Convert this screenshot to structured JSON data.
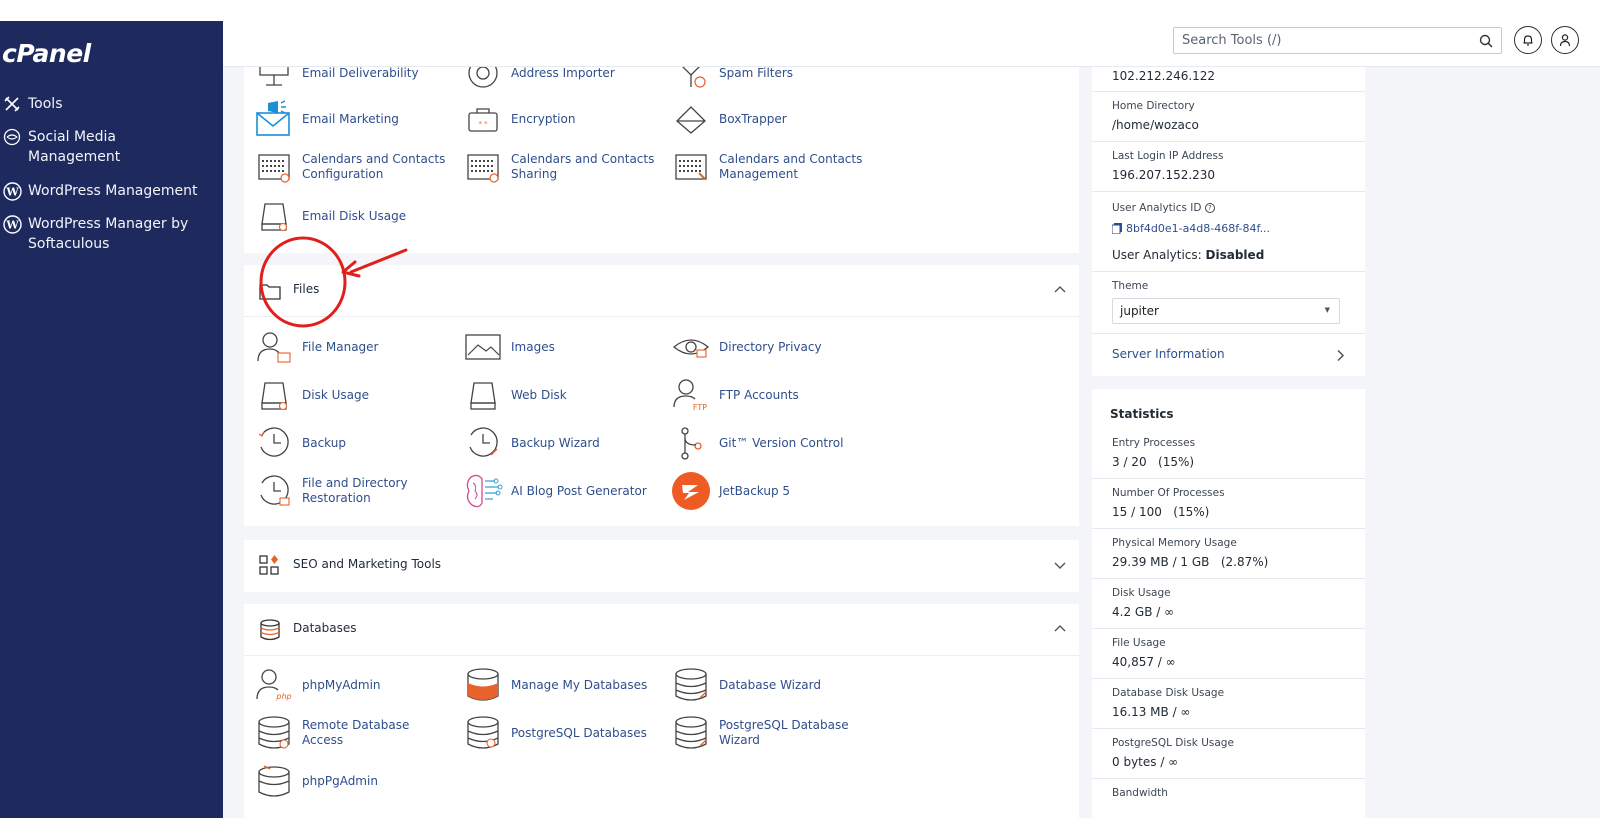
{
  "sidebar": {
    "logo": "cPanel",
    "items": [
      {
        "label": "Tools"
      },
      {
        "label": "Social Media",
        "label2": "Management"
      },
      {
        "label": "WordPress Management"
      },
      {
        "label": "WordPress Manager by",
        "label2": "Softaculous"
      }
    ]
  },
  "search": {
    "placeholder": "Search Tools (/)"
  },
  "email_tools": [
    {
      "label": "Email Deliverability"
    },
    {
      "label": "Address Importer"
    },
    {
      "label": "Spam Filters"
    },
    {
      "label": "Email Marketing"
    },
    {
      "label": "Encryption"
    },
    {
      "label": "BoxTrapper"
    },
    {
      "label": "Calendars and Contacts",
      "label2": "Configuration"
    },
    {
      "label": "Calendars and Contacts",
      "label2": "Sharing"
    },
    {
      "label": "Calendars and Contacts",
      "label2": "Management"
    },
    {
      "label": "Email Disk Usage"
    }
  ],
  "files": {
    "title": "Files",
    "tools": [
      {
        "label": "File Manager"
      },
      {
        "label": "Images"
      },
      {
        "label": "Directory Privacy"
      },
      {
        "label": "Disk Usage"
      },
      {
        "label": "Web Disk"
      },
      {
        "label": "FTP Accounts"
      },
      {
        "label": "Backup"
      },
      {
        "label": "Backup Wizard"
      },
      {
        "label": "Git™ Version Control"
      },
      {
        "label": "File and Directory",
        "label2": "Restoration"
      },
      {
        "label": "AI Blog Post Generator"
      },
      {
        "label": "JetBackup 5"
      }
    ]
  },
  "seo": {
    "title": "SEO and Marketing Tools"
  },
  "databases": {
    "title": "Databases",
    "tools": [
      {
        "label": "phpMyAdmin"
      },
      {
        "label": "Manage My Databases"
      },
      {
        "label": "Database Wizard"
      },
      {
        "label": "Remote Database Access"
      },
      {
        "label": "PostgreSQL Databases"
      },
      {
        "label": "PostgreSQL Database Wizard"
      },
      {
        "label": "phpPgAdmin"
      }
    ]
  },
  "general_info": {
    "ip_value": "102.212.246.122",
    "home_dir_label": "Home Directory",
    "home_dir_value": "/home/wozaco",
    "last_login_label": "Last Login IP Address",
    "last_login_value": "196.207.152.230",
    "analytics_id_label": "User Analytics ID",
    "analytics_id_value": "8bf4d0e1-a4d8-468f-84f...",
    "analytics_status_label": "User Analytics:",
    "analytics_status_value": "Disabled",
    "theme_label": "Theme",
    "theme_value": "jupiter",
    "server_info_label": "Server Information"
  },
  "statistics": {
    "title": "Statistics",
    "rows": [
      {
        "label": "Entry Processes",
        "value": "3 / 20   (15%)"
      },
      {
        "label": "Number Of Processes",
        "value": "15 / 100   (15%)"
      },
      {
        "label": "Physical Memory Usage",
        "value": "29.39 MB / 1 GB   (2.87%)"
      },
      {
        "label": "Disk Usage",
        "value": "4.2 GB / ∞"
      },
      {
        "label": "File Usage",
        "value": "40,857 / ∞"
      },
      {
        "label": "Database Disk Usage",
        "value": "16.13 MB / ∞"
      },
      {
        "label": "PostgreSQL Disk Usage",
        "value": "0 bytes / ∞"
      },
      {
        "label": "Bandwidth",
        "value": ""
      }
    ]
  },
  "colors": {
    "sidebar": "#1e2a5e",
    "link": "#2f4e8c",
    "accent_orange": "#e8622c",
    "annotation_red": "#e0201c"
  }
}
